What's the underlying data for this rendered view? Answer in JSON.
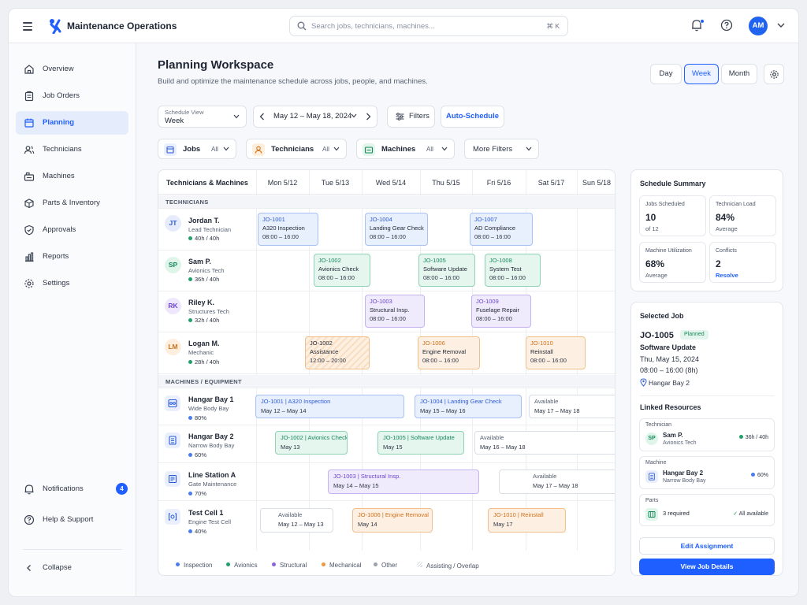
{
  "app": {
    "title": "Maintenance Operations"
  },
  "search": {
    "placeholder": "Search jobs, technicians, machines...",
    "shortcut": "⌘ K"
  },
  "user": {
    "initials": "AM"
  },
  "sidebar": {
    "items": [
      {
        "label": "Overview",
        "icon": "home-icon"
      },
      {
        "label": "Job Orders",
        "icon": "clipboard-icon"
      },
      {
        "label": "Planning",
        "icon": "calendar-icon",
        "active": true
      },
      {
        "label": "Technicians",
        "icon": "users-icon"
      },
      {
        "label": "Machines",
        "icon": "machine-icon"
      },
      {
        "label": "Parts & Inventory",
        "icon": "box-icon"
      },
      {
        "label": "Approvals",
        "icon": "shield-check-icon"
      },
      {
        "label": "Reports",
        "icon": "bar-chart-icon"
      },
      {
        "label": "Settings",
        "icon": "gear-icon"
      }
    ],
    "notifications": {
      "label": "Notifications",
      "count": "4"
    },
    "help": "Help & Support",
    "collapse": "Collapse"
  },
  "page": {
    "title": "Planning Workspace",
    "subtitle": "Build and optimize the maintenance schedule across jobs, people, and machines."
  },
  "view_toggle": {
    "day": "Day",
    "week": "Week",
    "month": "Month",
    "active": "Week"
  },
  "controls": {
    "schedule_view_label": "Schedule View",
    "schedule_view_value": "Week",
    "date_range": "May 12 – May 18, 2024",
    "filters": "Filters",
    "auto_schedule": "Auto-Schedule",
    "chips": [
      {
        "label": "Jobs",
        "value": "All"
      },
      {
        "label": "Technicians",
        "value": "All"
      },
      {
        "label": "Machines",
        "value": "All"
      }
    ],
    "more_filters": "More Filters"
  },
  "schedule": {
    "corner": "Technicians & Machines",
    "days": [
      "Mon 5/12",
      "Tue 5/13",
      "Wed 5/14",
      "Thu 5/15",
      "Fri 5/16",
      "Sat 5/17",
      "Sun 5/18"
    ],
    "sections": {
      "technicians": "TECHNICIANS",
      "machines": "MACHINES / EQUIPMENT"
    },
    "technicians": [
      {
        "initials": "JT",
        "name": "Jordan T.",
        "role": "Lead Technician",
        "load": "40h / 40h",
        "jobs": [
          {
            "id": "JO-1001",
            "title": "A320 Inspection",
            "time": "08:00 – 16:00",
            "cat": "ins"
          },
          {
            "id": "JO-1004",
            "title": "Landing Gear Check",
            "time": "08:00 – 16:00",
            "cat": "ins"
          },
          {
            "id": "JO-1007",
            "title": "AD Compliance",
            "time": "08:00 – 16:00",
            "cat": "ins"
          }
        ]
      },
      {
        "initials": "SP",
        "name": "Sam P.",
        "role": "Avionics Tech",
        "load": "36h / 40h",
        "jobs": [
          {
            "id": "JO-1002",
            "title": "Avionics Check",
            "time": "08:00 – 16:00",
            "cat": "avi"
          },
          {
            "id": "JO-1005",
            "title": "Software Update",
            "time": "08:00 – 16:00",
            "cat": "avi"
          },
          {
            "id": "JO-1008",
            "title": "System Test",
            "time": "08:00 – 16:00",
            "cat": "avi"
          }
        ]
      },
      {
        "initials": "RK",
        "name": "Riley K.",
        "role": "Structures Tech",
        "load": "32h / 40h",
        "jobs": [
          {
            "id": "JO-1003",
            "title": "Structural Insp.",
            "time": "08:00 – 16:00",
            "cat": "str"
          },
          {
            "id": "JO-1009",
            "title": "Fuselage Repair",
            "time": "08:00 – 16:00",
            "cat": "str"
          }
        ]
      },
      {
        "initials": "LM",
        "name": "Logan M.",
        "role": "Mechanic",
        "load": "28h / 40h",
        "jobs": [
          {
            "id": "JO-1002",
            "title": "Assistance",
            "time": "12:00 – 20:00",
            "cat": "asst"
          },
          {
            "id": "JO-1006",
            "title": "Engine Removal",
            "time": "08:00 – 16:00",
            "cat": "mec"
          },
          {
            "id": "JO-1010",
            "title": "Reinstall",
            "time": "08:00 – 16:00",
            "cat": "mec"
          }
        ]
      }
    ],
    "machines": [
      {
        "name": "Hangar Bay 1",
        "type": "Wide Body Bay",
        "util": "80%",
        "bars": [
          {
            "label": "JO-1001 | A320 Inspection",
            "dates": "May 12 – May 14",
            "cat": "ins"
          },
          {
            "label": "JO-1004 | Landing Gear Check",
            "dates": "May 15 – May 16",
            "cat": "ins"
          },
          {
            "label": "Available",
            "dates": "May 17 – May 18",
            "cat": "ava"
          }
        ]
      },
      {
        "name": "Hangar Bay 2",
        "type": "Narrow Body Bay",
        "util": "60%",
        "bars": [
          {
            "label": "JO-1002 | Avionics Check",
            "dates": "May 13",
            "cat": "avi"
          },
          {
            "label": "JO-1005 | Software Update",
            "dates": "May 15",
            "cat": "avi"
          },
          {
            "label": "Available",
            "dates": "May 16 – May 18",
            "cat": "ava"
          }
        ]
      },
      {
        "name": "Line Station A",
        "type": "Gate Maintenance",
        "util": "70%",
        "bars": [
          {
            "label": "JO-1003 | Structural Insp.",
            "dates": "May 14 – May 15",
            "cat": "str"
          },
          {
            "label": "Available",
            "dates": "May 17 – May 18",
            "cat": "ava"
          }
        ]
      },
      {
        "name": "Test Cell 1",
        "type": "Engine Test Cell",
        "util": "40%",
        "bars": [
          {
            "label": "Available",
            "dates": "May 12 – May 13",
            "cat": "ava"
          },
          {
            "label": "JO-1006 | Engine Removal",
            "dates": "May 14",
            "cat": "mec"
          },
          {
            "label": "JO-1010 | Reinstall",
            "dates": "May 17",
            "cat": "mec"
          }
        ]
      }
    ],
    "legend": [
      "Inspection",
      "Avionics",
      "Structural",
      "Mechanical",
      "Other",
      "Assisting / Overlap"
    ]
  },
  "summary": {
    "title": "Schedule Summary",
    "stats": [
      {
        "label": "Jobs Scheduled",
        "value": "10",
        "sub": "of 12"
      },
      {
        "label": "Technician Load",
        "value": "84%",
        "sub": "Average"
      },
      {
        "label": "Machine Utilization",
        "value": "68%",
        "sub": "Average"
      },
      {
        "label": "Conflicts",
        "value": "2",
        "sub": "Resolve"
      }
    ]
  },
  "selected_job": {
    "title": "Selected Job",
    "id": "JO-1005",
    "status": "Planned",
    "name": "Software Update",
    "date": "Thu, May 15, 2024",
    "time": "08:00 – 16:00 (8h)",
    "location": "Hangar Bay 2",
    "linked_title": "Linked Resources",
    "technician": {
      "label": "Technician",
      "initials": "SP",
      "name": "Sam P.",
      "role": "Avionics Tech",
      "load": "36h / 40h"
    },
    "machine": {
      "label": "Machine",
      "name": "Hangar Bay 2",
      "type": "Narrow Body Bay",
      "util": "60%"
    },
    "parts": {
      "label": "Parts",
      "required": "3 required",
      "status": "All available"
    },
    "edit_button": "Edit Assignment",
    "details_button": "View Job Details"
  },
  "colors": {
    "accent": "#1f5fff",
    "inspection": "#4a7cf0",
    "avionics": "#22a06b",
    "structural": "#8a63e0",
    "mechanical": "#f0963c",
    "other": "#9aa1ad"
  }
}
